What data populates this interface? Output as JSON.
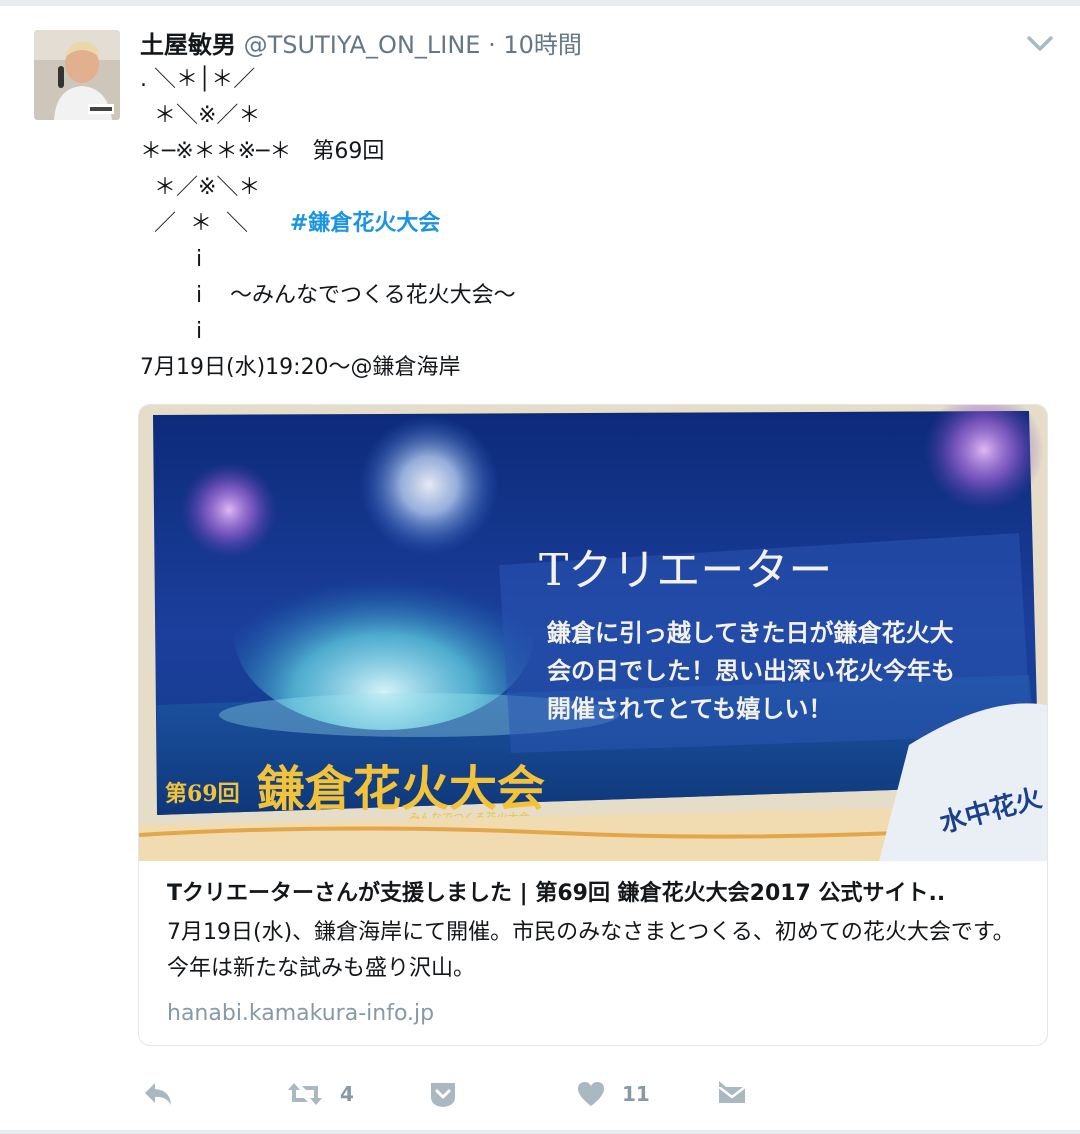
{
  "tweet": {
    "display_name": "土屋敏男",
    "handle": "@TSUTIYA_ON_LINE",
    "separator": "·",
    "time": "10時間",
    "lines": [
      ". ＼＊│＊／",
      "  ＊＼※／＊",
      "＊─※＊＊※─＊   第69回",
      "  ＊／※＼＊",
      "  ／  ＊  ＼",
      "        i",
      "        i    ～みんなでつくる花火大会～",
      "        i",
      "7月19日(水)19:20～@鎌倉海岸"
    ],
    "hashtag_prefix": "  ／  ＊  ＼      ",
    "hashtag": "#鎌倉花火大会"
  },
  "card": {
    "image": {
      "headline": "Tクリエーター",
      "message_lines": [
        "鎌倉に引っ越してきた日が鎌倉花火大",
        "会の日でした！思い出深い花火今年も",
        "開催されてとても嬉しい！"
      ],
      "logo_number": "第69回",
      "logo_main": "鎌倉花火大会",
      "logo_sub": "みんなでつくる花火大会",
      "corner_mark": "水中花火"
    },
    "title": "Tクリエーターさんが支援しました | 第69回 鎌倉花火大会2017 公式サイト..",
    "description": "7月19日(水)、鎌倉海岸にて開催。市民のみなさまとつくる、初めての花火大会です。今年は新たな試みも盛り沢山。",
    "url": "hanabi.kamakura-info.jp"
  },
  "actions": {
    "reply_icon": "reply-icon",
    "retweet_icon": "retweet-icon",
    "retweet_count": "4",
    "moments_icon": "moments-icon",
    "like_icon": "heart-icon",
    "like_count": "11",
    "dm_icon": "direct-message-icon"
  },
  "colors": {
    "link": "#1b95e0",
    "muted": "#657786",
    "icon": "#aab8c2",
    "card_sky": "#1b3a8c"
  }
}
